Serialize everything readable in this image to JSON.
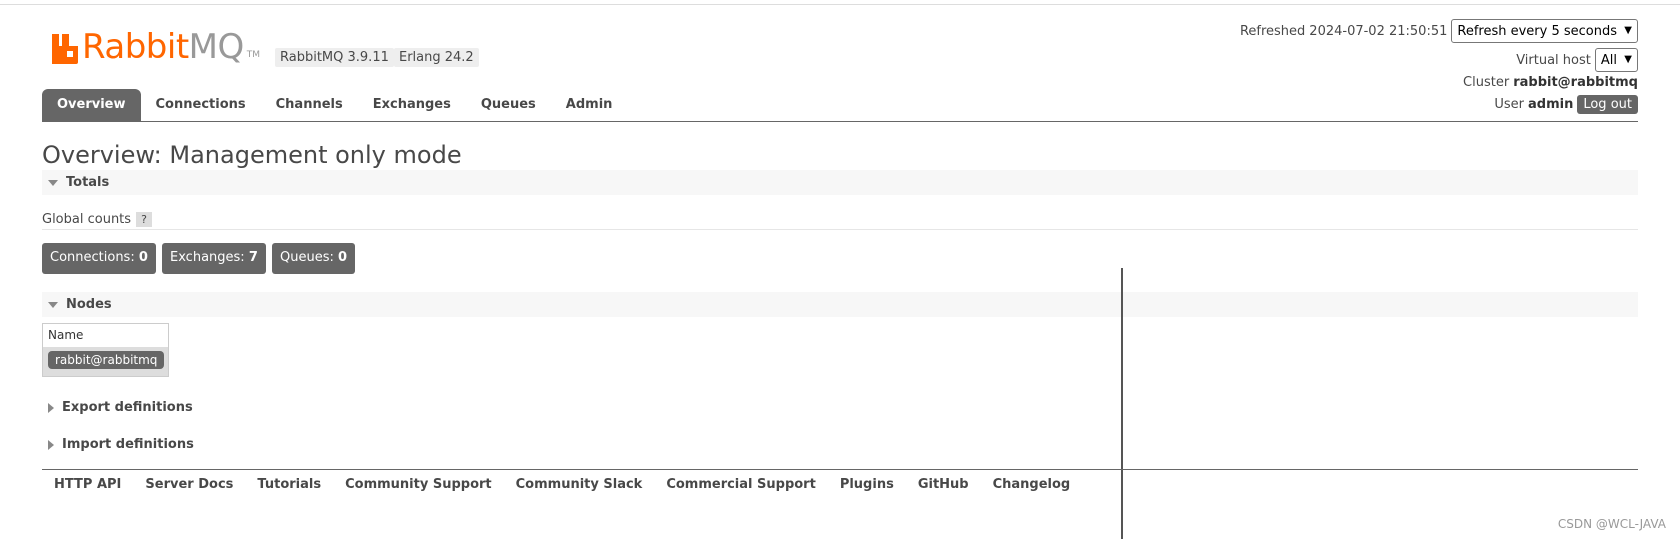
{
  "header": {
    "logo_rabbit": "Rabbit",
    "logo_mq": "MQ",
    "logo_tm": "TM",
    "version": "RabbitMQ 3.9.11",
    "erlang": "Erlang 24.2",
    "refreshed_label": "Refreshed",
    "refreshed_time": "2024-07-02 21:50:51",
    "refresh_select": "Refresh every 5 seconds",
    "virtual_host_label": "Virtual host",
    "virtual_host_value": "All",
    "cluster_label": "Cluster",
    "cluster_value": "rabbit@rabbitmq",
    "user_label": "User",
    "user_value": "admin",
    "logout_label": "Log out"
  },
  "tabs": [
    {
      "label": "Overview",
      "active": true
    },
    {
      "label": "Connections",
      "active": false
    },
    {
      "label": "Channels",
      "active": false
    },
    {
      "label": "Exchanges",
      "active": false
    },
    {
      "label": "Queues",
      "active": false
    },
    {
      "label": "Admin",
      "active": false
    }
  ],
  "page_title": "Overview: Management only mode",
  "totals": {
    "title": "Totals",
    "global_counts_label": "Global counts",
    "help": "?",
    "counts": [
      {
        "label": "Connections:",
        "value": "0"
      },
      {
        "label": "Exchanges:",
        "value": "7"
      },
      {
        "label": "Queues:",
        "value": "0"
      }
    ]
  },
  "nodes": {
    "title": "Nodes",
    "column_name": "Name",
    "rows": [
      {
        "name": "rabbit@rabbitmq"
      }
    ]
  },
  "export_definitions": "Export definitions",
  "import_definitions": "Import definitions",
  "footer_links": [
    "HTTP API",
    "Server Docs",
    "Tutorials",
    "Community Support",
    "Community Slack",
    "Commercial Support",
    "Plugins",
    "GitHub",
    "Changelog"
  ],
  "watermark": "CSDN @WCL-JAVA",
  "colors": {
    "brand": "#ff6600",
    "tab_active": "#666666"
  }
}
